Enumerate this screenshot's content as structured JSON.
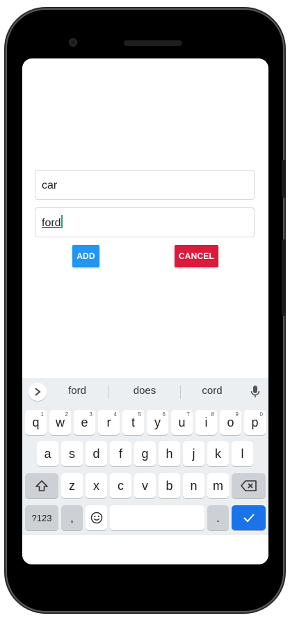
{
  "form": {
    "field1_value": "car",
    "field2_value": "ford"
  },
  "buttons": {
    "add": "ADD",
    "cancel": "CANCEL"
  },
  "keyboard": {
    "suggestions": [
      "ford",
      "does",
      "cord"
    ],
    "row1": [
      {
        "k": "q",
        "h": "1"
      },
      {
        "k": "w",
        "h": "2"
      },
      {
        "k": "e",
        "h": "3"
      },
      {
        "k": "r",
        "h": "4"
      },
      {
        "k": "t",
        "h": "5"
      },
      {
        "k": "y",
        "h": "6"
      },
      {
        "k": "u",
        "h": "7"
      },
      {
        "k": "i",
        "h": "8"
      },
      {
        "k": "o",
        "h": "9"
      },
      {
        "k": "p",
        "h": "0"
      }
    ],
    "row2": [
      "a",
      "s",
      "d",
      "f",
      "g",
      "h",
      "j",
      "k",
      "l"
    ],
    "row3": [
      "z",
      "x",
      "c",
      "v",
      "b",
      "n",
      "m"
    ],
    "symbols_label": "?123",
    "comma": ",",
    "period": "."
  },
  "colors": {
    "add_button": "#2196f3",
    "cancel_button": "#dc1a3c",
    "enter_key": "#1a73e8",
    "cursor": "#17a589"
  }
}
